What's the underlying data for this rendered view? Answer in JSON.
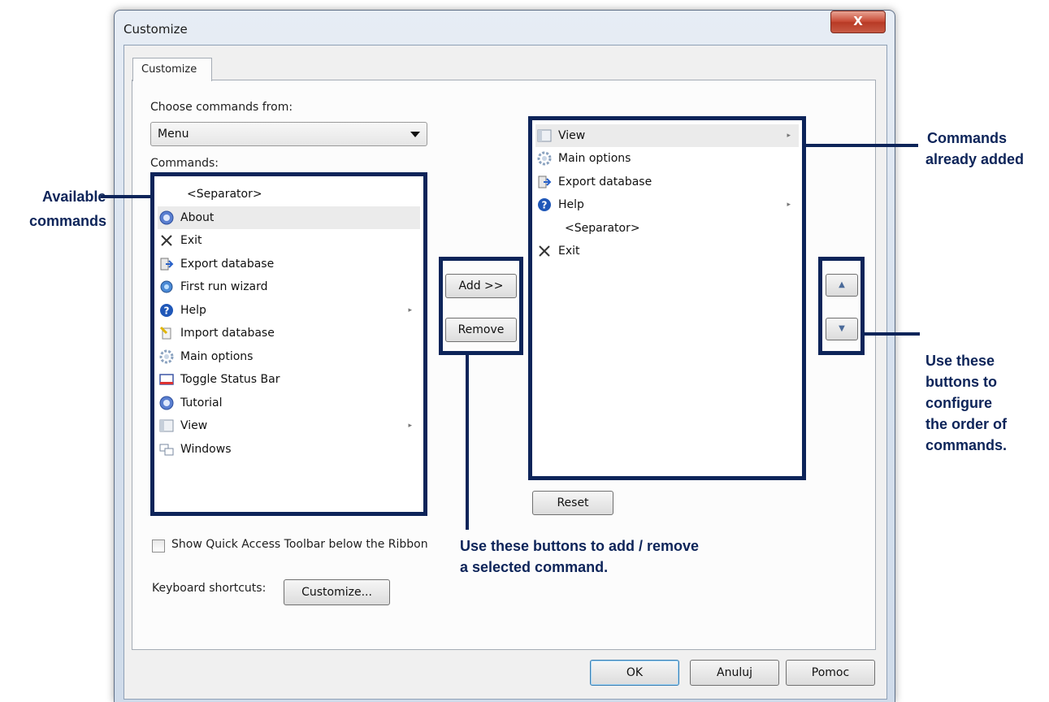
{
  "window": {
    "title": "Customize",
    "close_label": "X"
  },
  "tab": {
    "label": "Customize"
  },
  "choose_label": "Choose commands from:",
  "combo_value": "Menu",
  "commands_label": "Commands:",
  "left_items": [
    {
      "label": "<Separator>",
      "icon": "none"
    },
    {
      "label": "About",
      "icon": "about-icon"
    },
    {
      "label": "Exit",
      "icon": "exit-icon"
    },
    {
      "label": "Export database",
      "icon": "export-icon"
    },
    {
      "label": "First run wizard",
      "icon": "wizard-icon"
    },
    {
      "label": "Help",
      "icon": "help-icon",
      "submenu": "▸"
    },
    {
      "label": "Import database",
      "icon": "import-icon"
    },
    {
      "label": "Main options",
      "icon": "gear-icon"
    },
    {
      "label": "Toggle Status Bar",
      "icon": "statusbar-icon"
    },
    {
      "label": "Tutorial",
      "icon": "tutorial-icon"
    },
    {
      "label": "View",
      "icon": "view-icon",
      "submenu": "▸"
    },
    {
      "label": "Windows",
      "icon": "windows-icon"
    }
  ],
  "right_items": [
    {
      "label": "View",
      "icon": "view-icon",
      "submenu": "▸"
    },
    {
      "label": "Main options",
      "icon": "gear-icon"
    },
    {
      "label": "Export database",
      "icon": "export-icon"
    },
    {
      "label": "Help",
      "icon": "help-icon",
      "submenu": "▸"
    },
    {
      "label": "<Separator>",
      "icon": "none"
    },
    {
      "label": "Exit",
      "icon": "exit-icon"
    }
  ],
  "buttons": {
    "add": "Add >>",
    "remove": "Remove",
    "reset": "Reset",
    "customize": "Customize...",
    "ok": "OK",
    "cancel": "Anuluj",
    "help": "Pomoc",
    "up": "▲",
    "down": "▼"
  },
  "show_qat_label": "Show Quick Access Toolbar below the Ribbon",
  "keyboard_label": "Keyboard shortcuts:",
  "annotations": {
    "available_1": "Available",
    "available_2": "commands",
    "added_1": "Commands",
    "added_2": "already added",
    "order_1": "Use these",
    "order_2": "buttons to",
    "order_3": "configure",
    "order_4": "the order of",
    "order_5": "commands.",
    "addremove_1": "Use these buttons to add / remove",
    "addremove_2": "a selected command."
  },
  "colors": {
    "annotation": "#0d2459"
  }
}
